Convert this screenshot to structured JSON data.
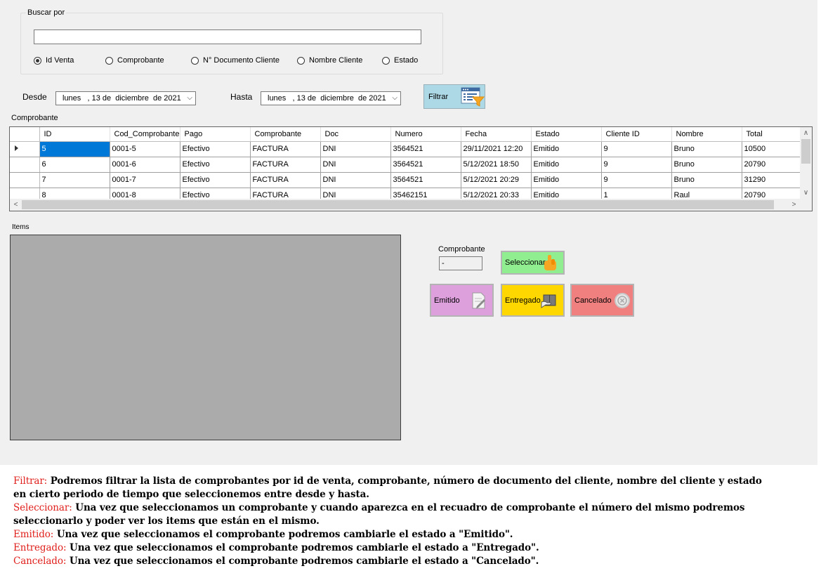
{
  "search": {
    "group_label": "Buscar por",
    "value": "",
    "options": [
      {
        "label": "Id Venta",
        "checked": true
      },
      {
        "label": "Comprobante",
        "checked": false
      },
      {
        "label": "N° Documento Cliente",
        "checked": false
      },
      {
        "label": "Nombre Cliente",
        "checked": false
      },
      {
        "label": "Estado",
        "checked": false
      }
    ]
  },
  "dates": {
    "desde_label": "Desde",
    "desde_value": "lunes   , 13 de  diciembre  de 2021",
    "hasta_label": "Hasta",
    "hasta_value": "lunes   , 13 de  diciembre  de 2021"
  },
  "filter_button": {
    "label": "Filtrar",
    "icon": "filter-list-icon"
  },
  "grid": {
    "label": "Comprobante",
    "columns": [
      "ID",
      "Cod_Comprobante",
      "Pago",
      "Comprobante",
      "Doc",
      "Numero",
      "Fecha",
      "Estado",
      "Cliente ID",
      "Nombre",
      "Total"
    ],
    "rows": [
      [
        "5",
        "0001-5",
        "Efectivo",
        "FACTURA",
        "DNI",
        "3564521",
        "29/11/2021 12:20",
        "Emitido",
        "9",
        "Bruno",
        "10500"
      ],
      [
        "6",
        "0001-6",
        "Efectivo",
        "FACTURA",
        "DNI",
        "3564521",
        "5/12/2021 18:50",
        "Emitido",
        "9",
        "Bruno",
        "20790"
      ],
      [
        "7",
        "0001-7",
        "Efectivo",
        "FACTURA",
        "DNI",
        "3564521",
        "5/12/2021 20:29",
        "Emitido",
        "9",
        "Bruno",
        "31290"
      ],
      [
        "8",
        "0001-8",
        "Efectivo",
        "FACTURA",
        "DNI",
        "35462151",
        "5/12/2021 20:33",
        "Emitido",
        "1",
        "Raul",
        "20790"
      ]
    ],
    "selected_row": 0
  },
  "items": {
    "label": "Items"
  },
  "comprobante": {
    "label": "Comprobante",
    "value": "-"
  },
  "buttons": {
    "seleccionar": {
      "label": "Seleccionar",
      "color": "#90ee90",
      "icon": "hand-pointer-icon"
    },
    "emitido": {
      "label": "Emitido",
      "color": "#dda0dd",
      "icon": "document-edit-icon"
    },
    "entregado": {
      "label": "Entregado",
      "color": "#ffd700",
      "icon": "package-icon"
    },
    "cancelado": {
      "label": "Cancelado",
      "color": "#f08080",
      "icon": "cancel-circle-icon"
    }
  },
  "description": [
    {
      "key": "Filtrar:",
      "text": " Podremos filtrar la lista de comprobantes por id de venta, comprobante, número de documento del cliente, nombre del cliente y estado en cierto periodo de tiempo que seleccionemos entre desde y hasta."
    },
    {
      "key": "Seleccionar:",
      "text": " Una vez que seleccionamos un comprobante y cuando aparezca en el recuadro de comprobante el número del mismo podremos seleccionarlo y poder ver los items que están en el mismo."
    },
    {
      "key": "Emitido:",
      "text": " Una vez que seleccionamos el comprobante podremos cambiarle el estado a \"Emitido\"."
    },
    {
      "key": "Entregado:",
      "text": " Una vez que seleccionamos el comprobante podremos cambiarle el estado a \"Entregado\"."
    },
    {
      "key": "Cancelado:",
      "text": " Una vez que seleccionamos el comprobante podremos cambiarle el estado a \"Cancelado\"."
    }
  ]
}
